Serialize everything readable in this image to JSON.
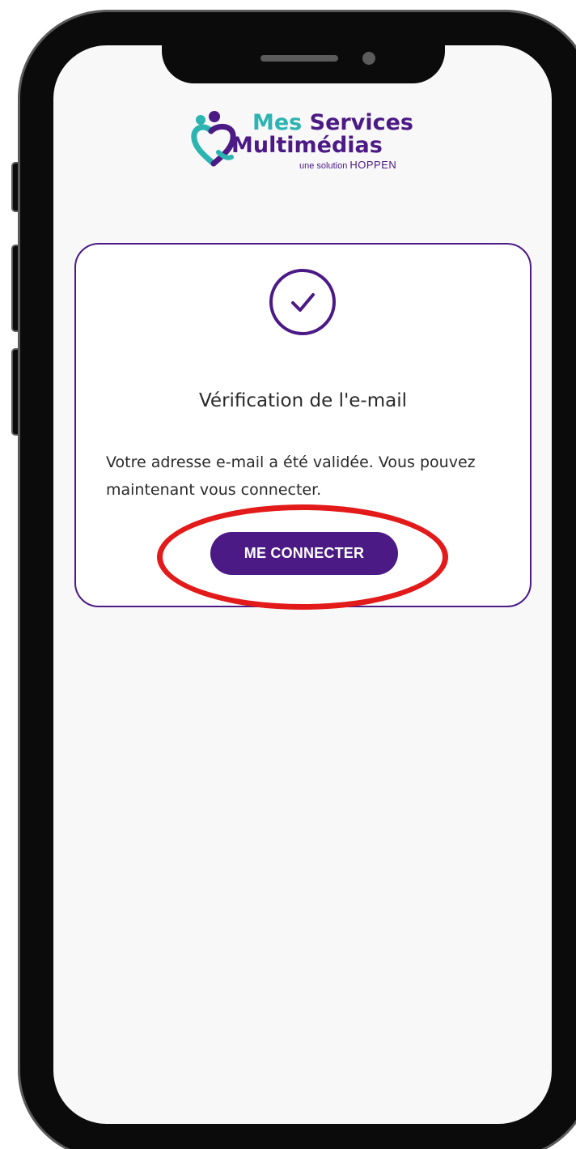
{
  "logo": {
    "line1_word1": "Mes",
    "line1_word2": "Services",
    "line2": "Multimédias",
    "tagline_prefix": "une solution",
    "tagline_brand": "HOPPEN",
    "colors": {
      "teal": "#2bb4b1",
      "purple": "#4b1a85"
    }
  },
  "card": {
    "icon": "check-circle-icon",
    "title": "Vérification de l'e-mail",
    "message": "Votre adresse e-mail a été validée. Vous pouvez maintenant vous connecter.",
    "button_label": "ME CONNECTER"
  },
  "annotation": {
    "highlight_color": "#e31a1a"
  },
  "theme": {
    "accent": "#4b1a85",
    "screen_background": "#f8f8f9",
    "frame": "#0b0b0b"
  }
}
